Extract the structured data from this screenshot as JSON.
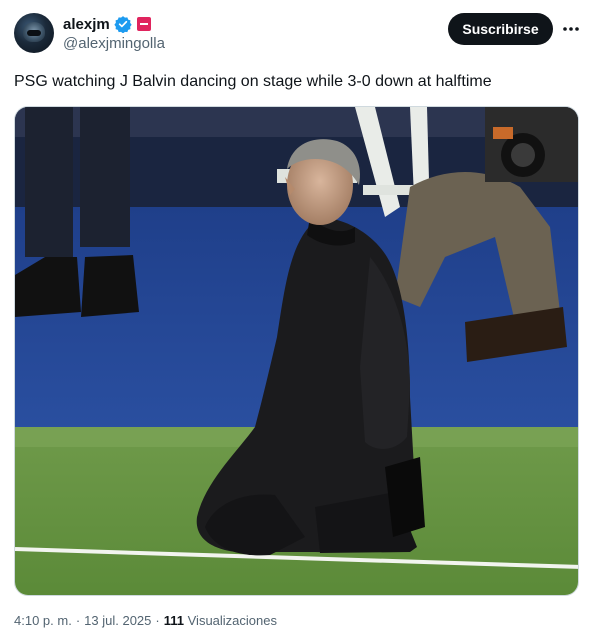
{
  "author": {
    "display_name": "alexjm",
    "handle": "@alexjmingolla",
    "verified": true
  },
  "actions": {
    "subscribe_label": "Suscribirse"
  },
  "tweet": {
    "text": "PSG watching J Balvin dancing on stage while 3-0 down at halftime"
  },
  "meta": {
    "time": "4:10 p. m.",
    "separator": "·",
    "date": "13 jul. 2025",
    "views_count": "111",
    "views_label": "Visualizaciones"
  },
  "colors": {
    "verified_blue": "#1d9bf0",
    "badge_red": "#e0245e",
    "button_bg": "#0f1419",
    "secondary_text": "#536471"
  },
  "icons": [
    "verified-badge-icon",
    "affiliate-flag-icon",
    "more-options-icon"
  ]
}
